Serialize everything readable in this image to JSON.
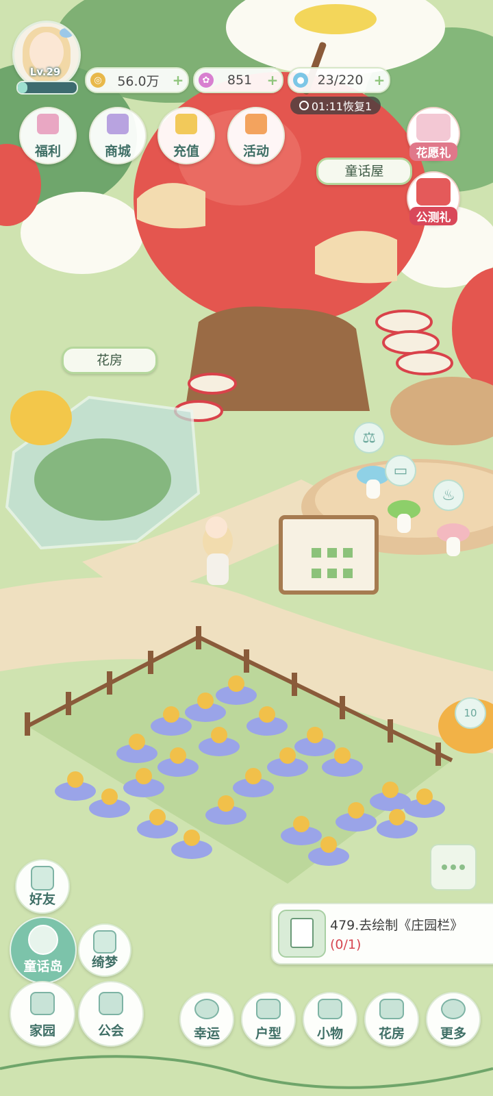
{
  "player": {
    "level": "Lv.29",
    "xp_fraction": 0.16
  },
  "resources": [
    {
      "name": "gold",
      "icon": "coin-icon",
      "value": "56.0万",
      "color": "#e8b84a"
    },
    {
      "name": "star",
      "icon": "star-gem-icon",
      "value": "851",
      "color": "#d87fd0"
    },
    {
      "name": "water",
      "icon": "water-drop-icon",
      "value": "23/220",
      "color": "#7cc6e6"
    }
  ],
  "stamina_timer": "01:11恢复1",
  "top_menu": [
    {
      "id": "welfare",
      "label": "福利",
      "icon": "gift-icon",
      "color": "#e9a7c3"
    },
    {
      "id": "shop",
      "label": "商城",
      "icon": "cart-icon",
      "color": "#b8a3e0"
    },
    {
      "id": "recharge",
      "label": "充值",
      "icon": "v-badge-icon",
      "color": "#f2c95a"
    },
    {
      "id": "events",
      "label": "活动",
      "icon": "gamepad-icon",
      "color": "#f3a35e"
    }
  ],
  "promos": [
    {
      "id": "flower-wish",
      "label": "花愿礼",
      "icon": "flower-wish-icon",
      "color": "#e0788a"
    },
    {
      "id": "beta-gift",
      "label": "公测礼",
      "icon": "apple-gift-icon",
      "color": "#d9485a"
    }
  ],
  "map_signs": {
    "fairy_house": "童话屋",
    "greenhouse": "花房"
  },
  "badge_counter": "10",
  "quest": {
    "title": "479.去绘制《庄园栏》",
    "progress": "(0/1)"
  },
  "side_nav": [
    {
      "id": "friends",
      "label": "好友",
      "icon": "friend-icon"
    },
    {
      "id": "fairy-island",
      "label": "童话岛",
      "icon": "flower-island-icon"
    },
    {
      "id": "dream",
      "label": "绮梦",
      "icon": "dream-brush-icon"
    }
  ],
  "bottom_nav": [
    {
      "id": "home",
      "label": "家园",
      "icon": "house-icon"
    },
    {
      "id": "guild",
      "label": "公会",
      "icon": "guild-icon"
    },
    {
      "id": "luck",
      "label": "幸运",
      "icon": "luck-wheel-icon"
    },
    {
      "id": "layout",
      "label": "户型",
      "icon": "cube-layout-icon"
    },
    {
      "id": "items",
      "label": "小物",
      "icon": "castle-icon"
    },
    {
      "id": "flower-room",
      "label": "花房",
      "icon": "lotus-icon"
    },
    {
      "id": "more",
      "label": "更多",
      "icon": "chevron-up-icon"
    }
  ]
}
